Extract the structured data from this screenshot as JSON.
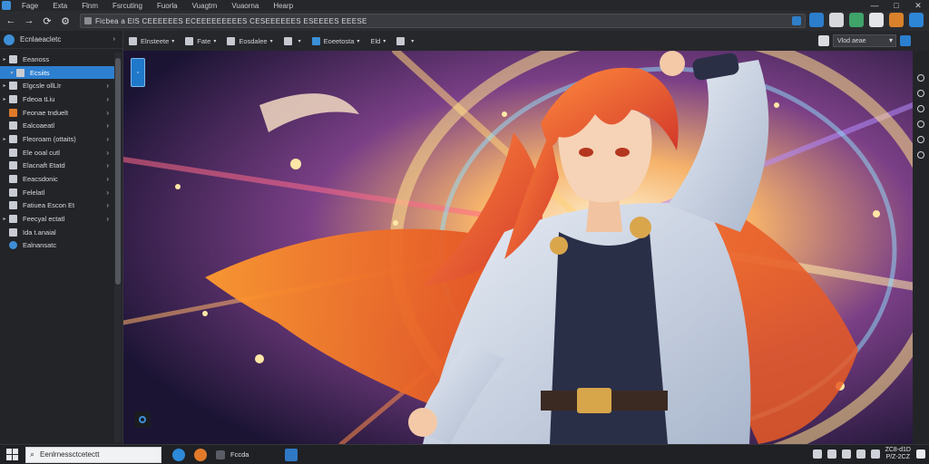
{
  "menubar": {
    "items": [
      "Fage",
      "Exta",
      "Flnm",
      "Fsrcuting",
      "Fuorla",
      "Vuagtrn",
      "Vuaorna",
      "Hearp"
    ]
  },
  "navbar": {
    "address": "Ficbea a ElS CEEEEEES ECEEEEEEEEES CESEEEEEES ESEEEES EEESE"
  },
  "sidebar": {
    "header": "Ecnlaeacletc",
    "items": [
      {
        "label": "Eeanoss",
        "arrow": "▸",
        "level": 0,
        "active": false,
        "chev": false
      },
      {
        "label": "Ecsiits",
        "arrow": "▾",
        "level": 1,
        "active": true,
        "chev": false
      },
      {
        "label": "Elgcsle ollLIr",
        "arrow": "▸",
        "level": 0,
        "active": false,
        "chev": true
      },
      {
        "label": "Fdeoa tLiu",
        "arrow": "▸",
        "level": 0,
        "active": false,
        "chev": true
      },
      {
        "label": "Feonae tnduelt",
        "arrow": "",
        "level": 0,
        "active": false,
        "chev": true
      },
      {
        "label": "Ealcoaeatl",
        "arrow": "",
        "level": 0,
        "active": false,
        "chev": true
      },
      {
        "label": "Fleoroam (ottaits)",
        "arrow": "▸",
        "level": 0,
        "active": false,
        "chev": true
      },
      {
        "label": "Ele ooal cutl",
        "arrow": "",
        "level": 0,
        "active": false,
        "chev": true
      },
      {
        "label": "Elacnaft Etatd",
        "arrow": "",
        "level": 0,
        "active": false,
        "chev": true
      },
      {
        "label": "Eeacsdonic",
        "arrow": "",
        "level": 0,
        "active": false,
        "chev": true
      },
      {
        "label": "Felelatl",
        "arrow": "",
        "level": 0,
        "active": false,
        "chev": true
      },
      {
        "label": "Fatiuea Escon Et",
        "arrow": "",
        "level": 0,
        "active": false,
        "chev": true
      },
      {
        "label": "Feecyal ectatl",
        "arrow": "▸",
        "level": 0,
        "active": false,
        "chev": true
      },
      {
        "label": "Ida t.anaial",
        "arrow": "",
        "level": 0,
        "active": false,
        "chev": false
      },
      {
        "label": "Ealnansatc",
        "arrow": "",
        "level": 0,
        "active": false,
        "chev": false
      }
    ]
  },
  "toolbar2": {
    "items": [
      "Elnsteete",
      "Fate",
      "Eosdalee",
      "",
      "Eoeetosta",
      "Eld"
    ],
    "select_value": "Vlod aeae"
  },
  "taskbar": {
    "search": "Eenlrnessctcetectt",
    "app_label": "Fccda",
    "clock_line1": "ZC8-d1D",
    "clock_line2": "P/Z-2CZ"
  },
  "colors": {
    "accent": "#2d7fd0",
    "background": "#1e1f22"
  }
}
